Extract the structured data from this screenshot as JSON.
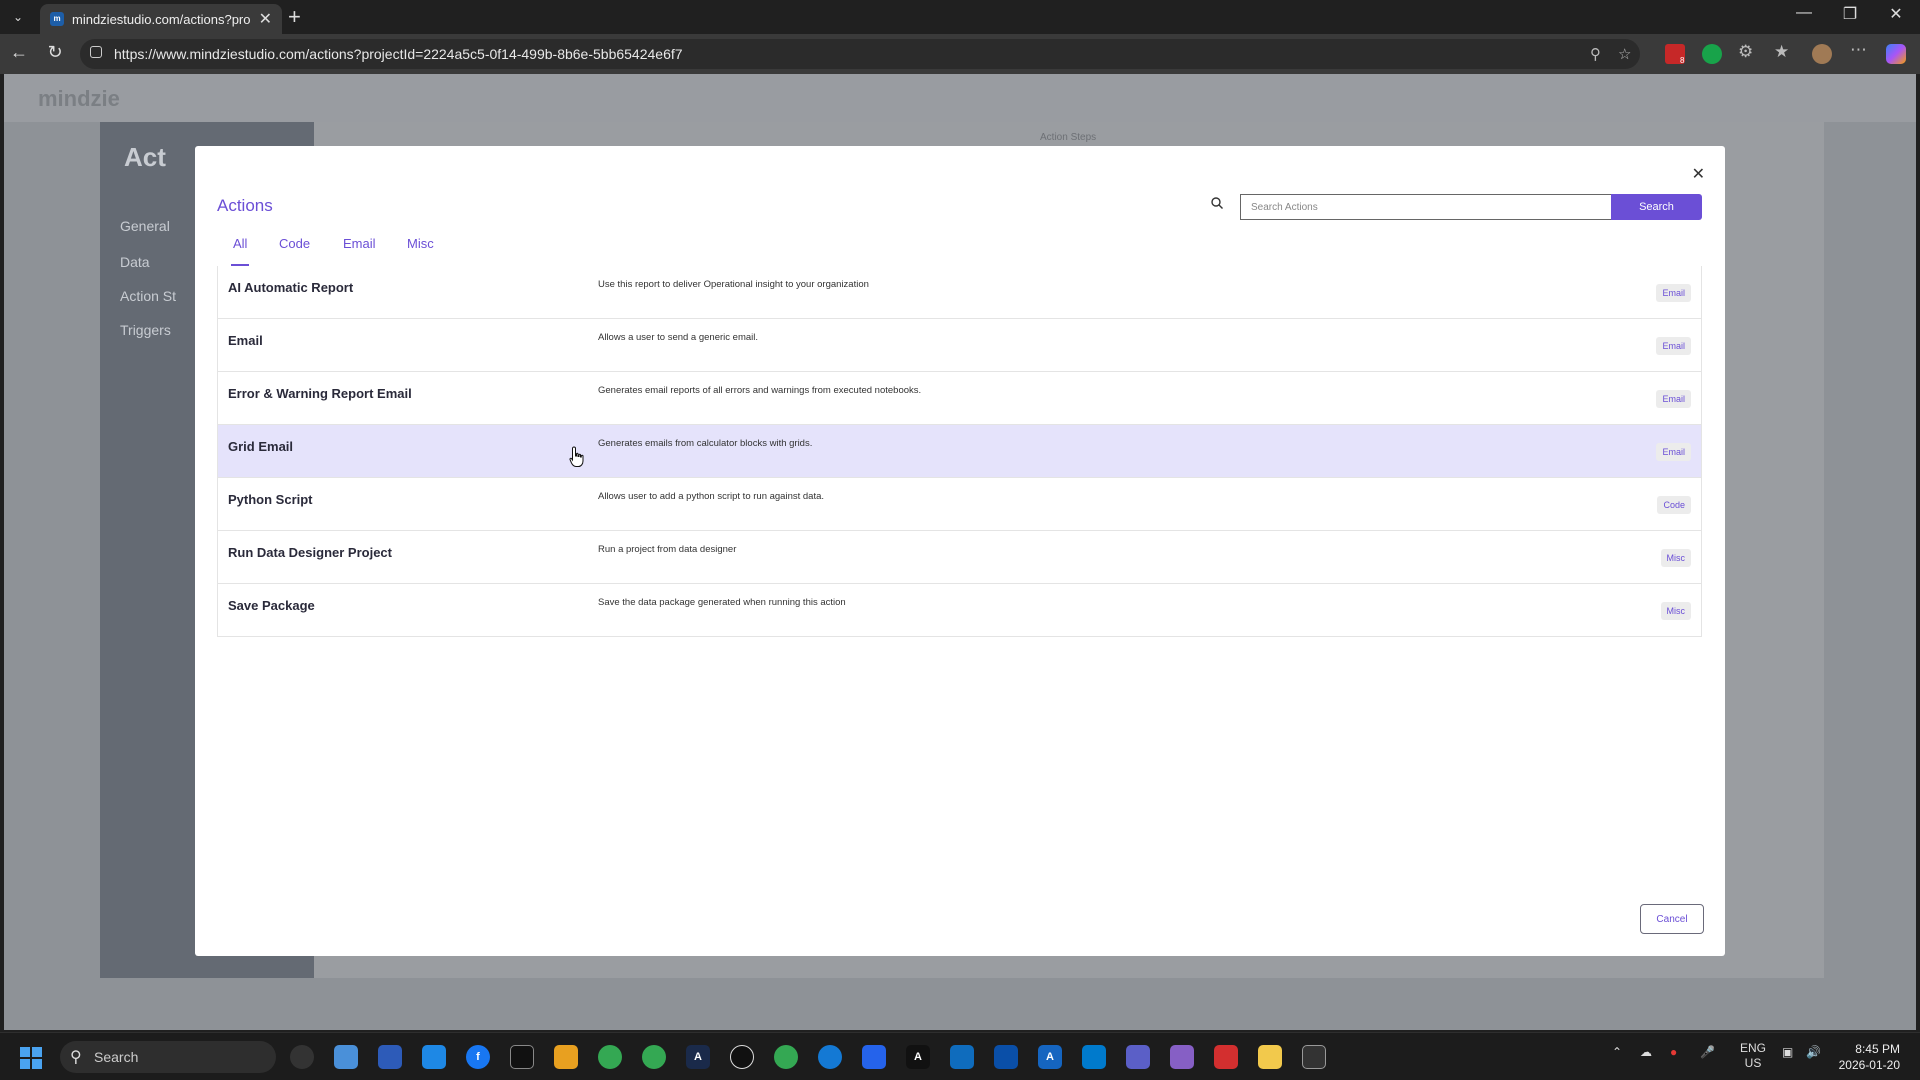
{
  "browser": {
    "tab_title": "mindziestudio.com/actions?proje",
    "url": "https://www.mindziestudio.com/actions?projectId=2224a5c5-0f14-499b-8b6e-5bb65424e6f7",
    "extension_badge": "8"
  },
  "background_app": {
    "logo": "mindzie",
    "title": "Act",
    "sidebar": [
      "General",
      "Data",
      "Action St",
      "Triggers"
    ],
    "header_label": "Action Steps"
  },
  "modal": {
    "title": "Actions",
    "search_placeholder": "Search Actions",
    "search_button": "Search",
    "tabs": [
      "All",
      "Code",
      "Email",
      "Misc"
    ],
    "active_tab": "All",
    "actions": [
      {
        "name": "AI Automatic Report",
        "description": "Use this report to deliver Operational insight to your organization",
        "category": "Email"
      },
      {
        "name": "Email",
        "description": "Allows a user to send a generic email.",
        "category": "Email"
      },
      {
        "name": "Error & Warning Report Email",
        "description": "Generates email reports of all errors and warnings from executed notebooks.",
        "category": "Email"
      },
      {
        "name": "Grid Email",
        "description": "Generates emails from calculator blocks with grids.",
        "category": "Email"
      },
      {
        "name": "Python Script",
        "description": "Allows user to add a python script to run against data.",
        "category": "Code"
      },
      {
        "name": "Run Data Designer Project",
        "description": "Run a project from data designer",
        "category": "Misc"
      },
      {
        "name": "Save Package",
        "description": "Save the data package generated when running this action",
        "category": "Misc"
      }
    ],
    "cancel_button": "Cancel"
  },
  "taskbar": {
    "search_placeholder": "Search",
    "language": "ENG",
    "region": "US",
    "time": "8:45 PM",
    "date": "2026-01-20"
  },
  "colors": {
    "accent": "#6b4fd6",
    "hover_row": "#e5e3fb",
    "overlay": "#8e9297"
  }
}
